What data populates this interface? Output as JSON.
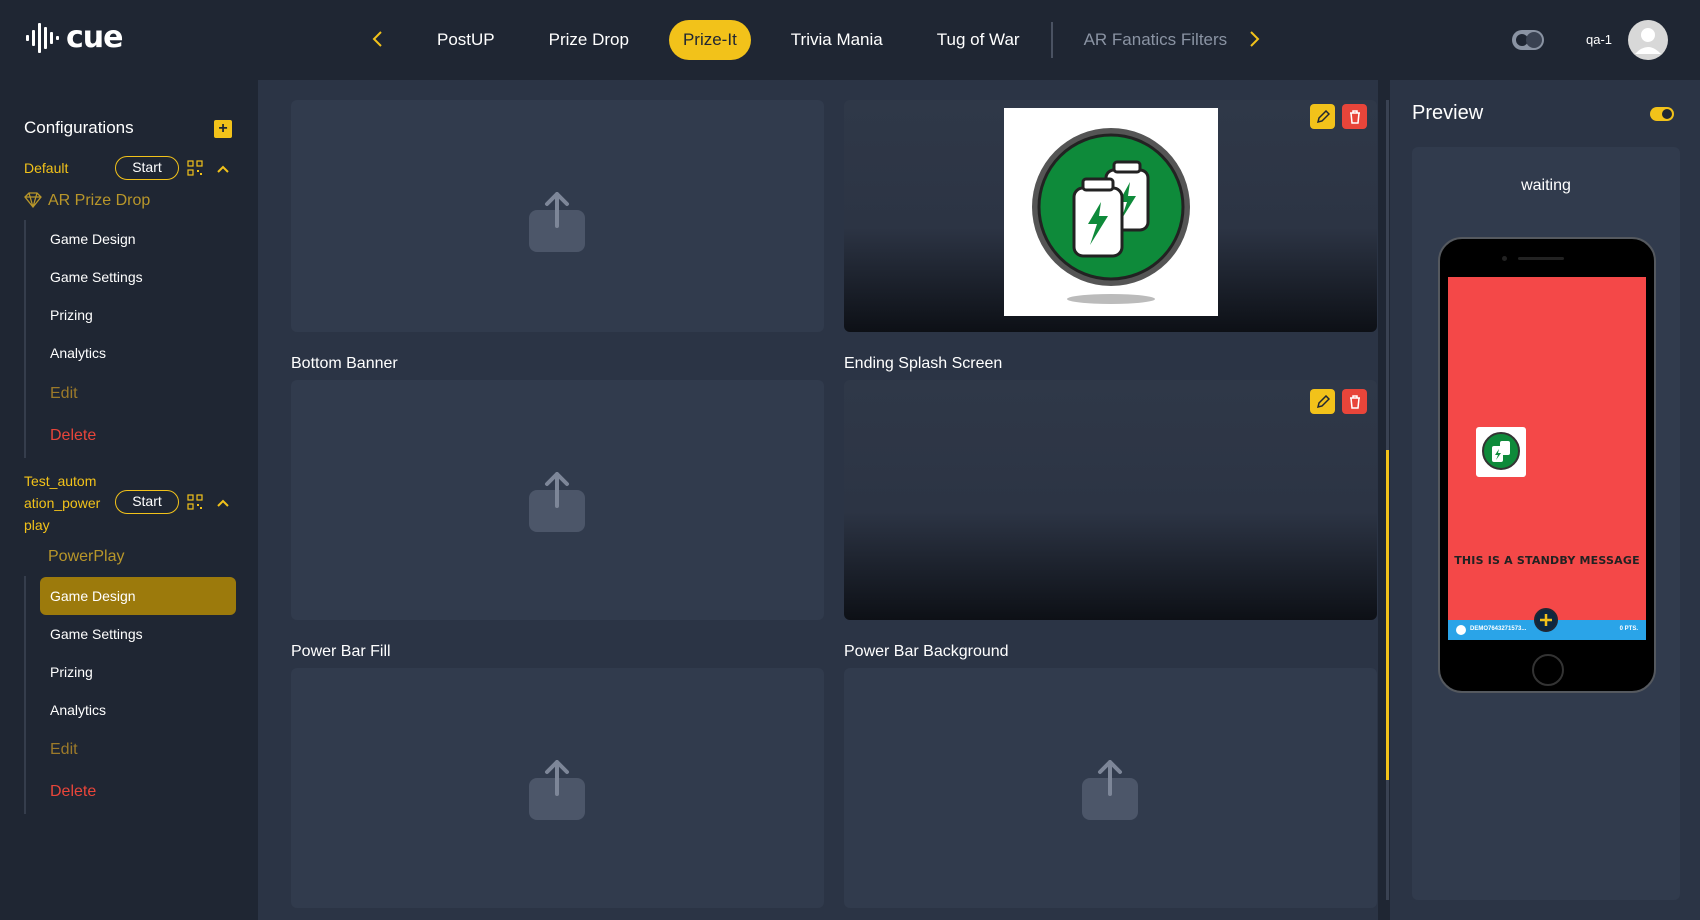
{
  "app": {
    "logo_text": "cue"
  },
  "header": {
    "tabs": [
      {
        "label": "PostUP"
      },
      {
        "label": "Prize Drop"
      },
      {
        "label": "Prize-It"
      },
      {
        "label": "Trivia Mania"
      },
      {
        "label": "Tug of War"
      },
      {
        "label": "AR Fanatics Filters"
      }
    ],
    "active_tab": "Prize-It",
    "user_name": "qa-1"
  },
  "sidebar": {
    "title": "Configurations",
    "add_label": "+",
    "configs": [
      {
        "name": "Default",
        "start_label": "Start",
        "game_type": "AR Prize Drop",
        "items": [
          "Game Design",
          "Game Settings",
          "Prizing",
          "Analytics"
        ],
        "edit_label": "Edit",
        "delete_label": "Delete"
      },
      {
        "name_lines": [
          "Test_autom",
          "ation_power",
          "play"
        ],
        "start_label": "Start",
        "game_type": "PowerPlay",
        "items": [
          "Game Design",
          "Game Settings",
          "Prizing",
          "Analytics"
        ],
        "active_item": "Game Design",
        "edit_label": "Edit",
        "delete_label": "Delete"
      }
    ]
  },
  "main": {
    "cards": [
      {
        "label": ""
      },
      {
        "label": ""
      },
      {
        "label": "Bottom Banner"
      },
      {
        "label": "Ending Splash Screen"
      },
      {
        "label": "Power Bar Fill"
      },
      {
        "label": "Power Bar Background"
      }
    ]
  },
  "preview": {
    "title": "Preview",
    "status": "waiting",
    "standby_message": "THIS IS A STANDBY MESSAGE",
    "bar_left": "DEMO7643271573...",
    "bar_right": "0 PTS."
  },
  "colors": {
    "accent": "#f2c21a",
    "danger": "#e8453a",
    "background": "#1f2633",
    "panel": "#2b3445"
  }
}
